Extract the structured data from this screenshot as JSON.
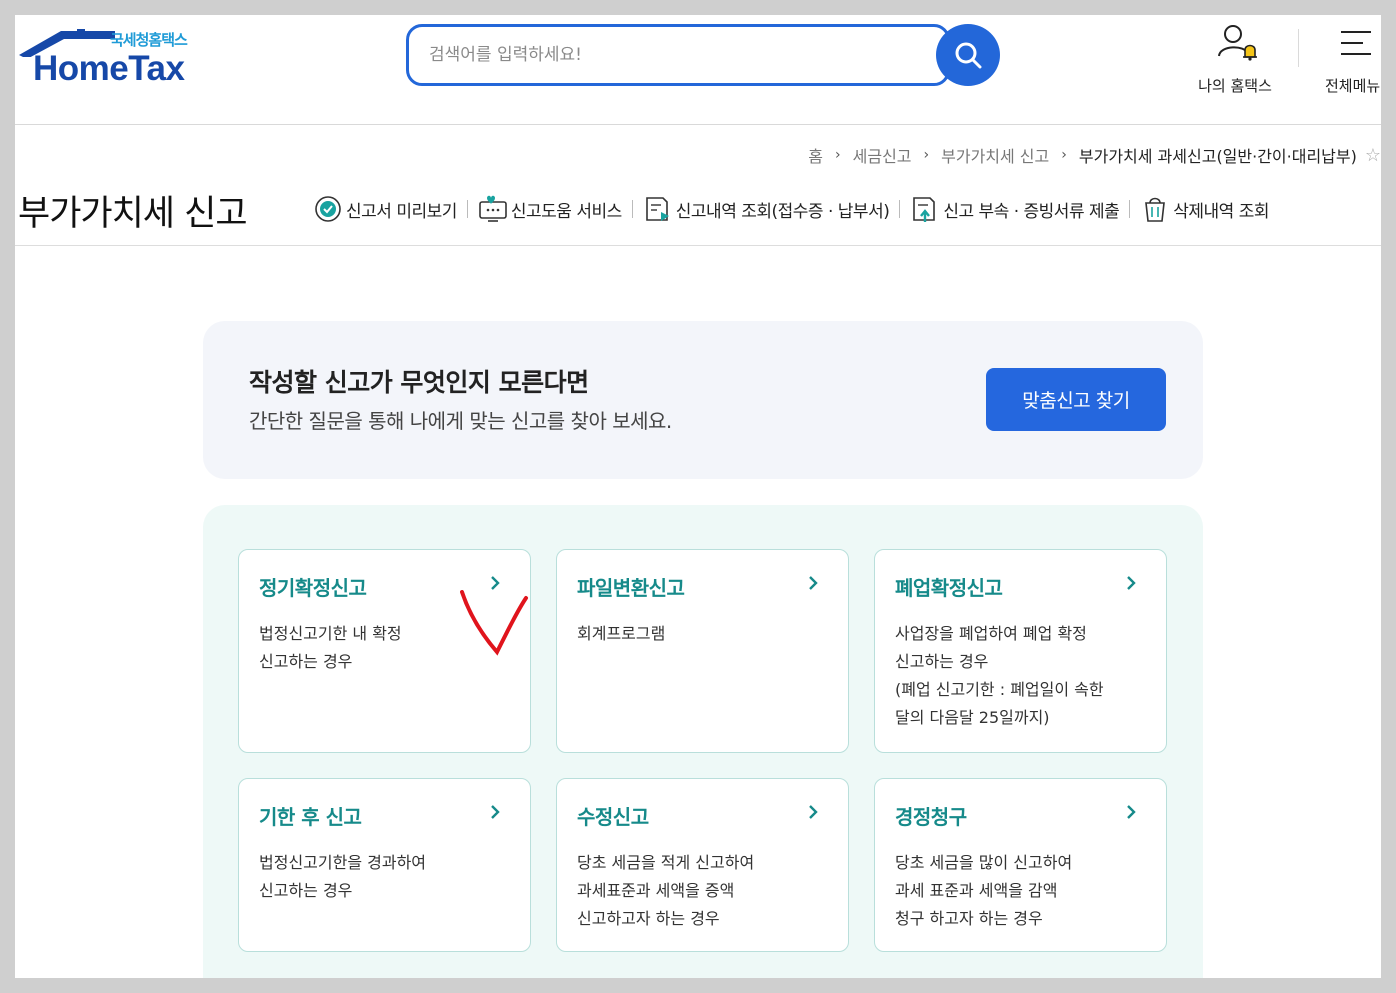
{
  "header": {
    "logo_gov": "국세청홈택스",
    "logo_brand": "HomeTax",
    "search_placeholder": "검색어를 입력하세요!",
    "my_hometax_label": "나의 홈택스",
    "all_menu_label": "전체메뉴"
  },
  "breadcrumb": [
    "홈",
    "세금신고",
    "부가가치세 신고",
    "부가가치세 과세신고(일반·간이·대리납부)"
  ],
  "page": {
    "title": "부가가치세 신고",
    "quick_links": [
      {
        "label": "신고서 미리보기",
        "icon": "check-circle-icon"
      },
      {
        "label": "신고도움 서비스",
        "icon": "monitor-heart-icon"
      },
      {
        "label": "신고내역 조회(접수증 · 납부서)",
        "icon": "document-search-icon"
      },
      {
        "label": "신고 부속 · 증빙서류 제출",
        "icon": "document-upload-icon"
      },
      {
        "label": "삭제내역 조회",
        "icon": "trash-icon"
      }
    ]
  },
  "banner": {
    "title": "작성할 신고가 무엇인지 모른다면",
    "desc": "간단한 질문을 통해 나에게 맞는 신고를 찾아 보세요.",
    "button": "맞춤신고 찾기"
  },
  "cards": [
    {
      "title": "정기확정신고",
      "lines": [
        "법정신고기한 내 확정",
        "신고하는 경우"
      ]
    },
    {
      "title": "파일변환신고",
      "lines": [
        "회계프로그램"
      ]
    },
    {
      "title": "폐업확정신고",
      "lines": [
        "사업장을 폐업하여 폐업 확정",
        "신고하는 경우",
        "(폐업 신고기한 : 폐업일이 속한",
        "달의 다음달 25일까지)"
      ]
    },
    {
      "title": "기한 후 신고",
      "lines": [
        "법정신고기한을 경과하여",
        "신고하는 경우"
      ]
    },
    {
      "title": "수정신고",
      "lines": [
        "당초 세금을 적게 신고하여",
        "과세표준과 세액을 증액",
        "신고하고자 하는 경우"
      ]
    },
    {
      "title": "경정청구",
      "lines": [
        "당초 세금을 많이 신고하여",
        "과세 표준과 세액을 감액",
        "청구 하고자 하는 경우"
      ]
    }
  ],
  "colors": {
    "brand_blue": "#2367d9",
    "card_title_teal": "#168a8a",
    "annotation_red": "#e0141c"
  }
}
